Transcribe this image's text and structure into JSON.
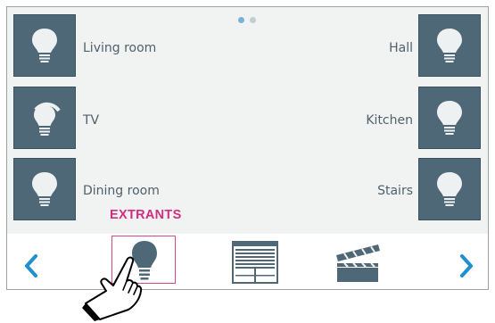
{
  "pager": {
    "pages": 2,
    "current": 1
  },
  "rooms_left": [
    {
      "label": "Living room",
      "icon": "bulb-icon"
    },
    {
      "label": "TV",
      "icon": "dimmer-bulb-icon"
    },
    {
      "label": "Dining room",
      "icon": "bulb-icon"
    }
  ],
  "rooms_right": [
    {
      "label": "Hall",
      "icon": "bulb-icon"
    },
    {
      "label": "Kitchen",
      "icon": "bulb-icon"
    },
    {
      "label": "Stairs",
      "icon": "bulb-icon"
    }
  ],
  "bottom_nav": {
    "items": [
      "light-category-icon",
      "blinds-category-icon",
      "scene-category-icon"
    ],
    "selected": "light-category-icon",
    "prev": "chevron-left-icon",
    "next": "chevron-right-icon"
  },
  "callout": {
    "text": "EXTRANTS"
  },
  "colors": {
    "tile": "#4f6878",
    "accent": "#1f8fd0",
    "callout": "#d22e7e",
    "label": "#50606a"
  }
}
